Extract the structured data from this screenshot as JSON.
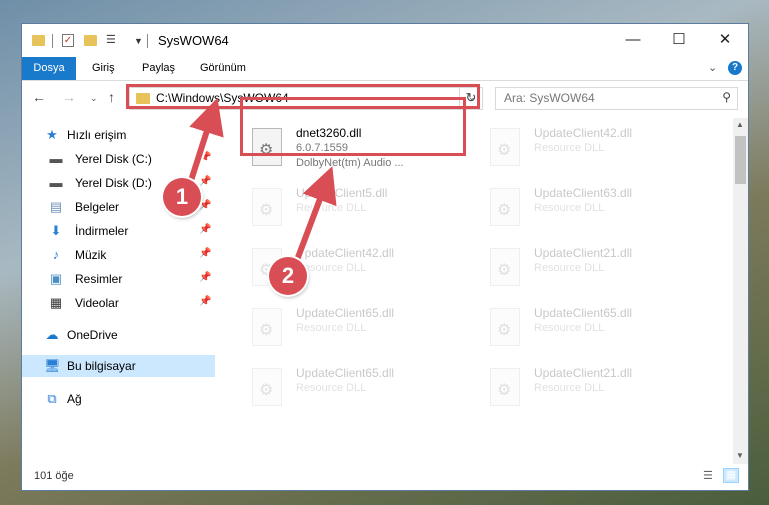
{
  "window": {
    "title": "SysWOW64",
    "controls": {
      "minimize": "—",
      "maximize": "☐",
      "close": "✕"
    }
  },
  "ribbon": {
    "tabs": [
      {
        "label": "Dosya",
        "active": true
      },
      {
        "label": "Giriş"
      },
      {
        "label": "Paylaş"
      },
      {
        "label": "Görünüm"
      }
    ]
  },
  "nav": {
    "address": "C:\\Windows\\SysWOW64",
    "search_placeholder": "Ara: SysWOW64"
  },
  "sidebar": {
    "items": [
      {
        "label": "Hızlı erişim",
        "icon": "star-icon",
        "pinned": false
      },
      {
        "label": "Yerel Disk (C:)",
        "icon": "drive-icon",
        "pinned": true
      },
      {
        "label": "Yerel Disk (D:)",
        "icon": "drive-icon",
        "pinned": true
      },
      {
        "label": "Belgeler",
        "icon": "documents-icon",
        "pinned": true
      },
      {
        "label": "İndirmeler",
        "icon": "download-icon",
        "pinned": true
      },
      {
        "label": "Müzik",
        "icon": "music-icon",
        "pinned": true
      },
      {
        "label": "Resimler",
        "icon": "pictures-icon",
        "pinned": true
      },
      {
        "label": "Videolar",
        "icon": "video-icon",
        "pinned": true
      },
      {
        "label": "OneDrive",
        "icon": "cloud-icon"
      },
      {
        "label": "Bu bilgisayar",
        "icon": "computer-icon",
        "selected": true
      },
      {
        "label": "Ağ",
        "icon": "network-icon"
      }
    ]
  },
  "files": {
    "highlighted": {
      "name": "dnet3260.dll",
      "version": "6.0.7.1559",
      "description": "DolbyNet(tm) Audio ..."
    },
    "faded": [
      {
        "name": "UpdateClient42.dll",
        "type": "Resource DLL"
      },
      {
        "name": "UpdateClient5.dll",
        "type": "Resource DLL"
      },
      {
        "name": "UpdateClient63.dll",
        "type": "Resource DLL"
      },
      {
        "name": "UpdateClient42.dll",
        "type": "Resource DLL"
      },
      {
        "name": "UpdateClient21.dll",
        "type": "Resource DLL"
      },
      {
        "name": "UpdateClient65.dll",
        "type": "Resource DLL"
      },
      {
        "name": "UpdateClient65.dll",
        "type": "Resource DLL"
      },
      {
        "name": "UpdateClient65.dll",
        "type": "Resource DLL"
      },
      {
        "name": "UpdateClient21.dll",
        "type": "Resource DLL"
      }
    ]
  },
  "status": {
    "count": "101 öğe"
  },
  "callouts": [
    "1",
    "2"
  ],
  "colors": {
    "accent": "#1979ca",
    "highlight": "#d94e55",
    "selection": "#cce8ff"
  }
}
